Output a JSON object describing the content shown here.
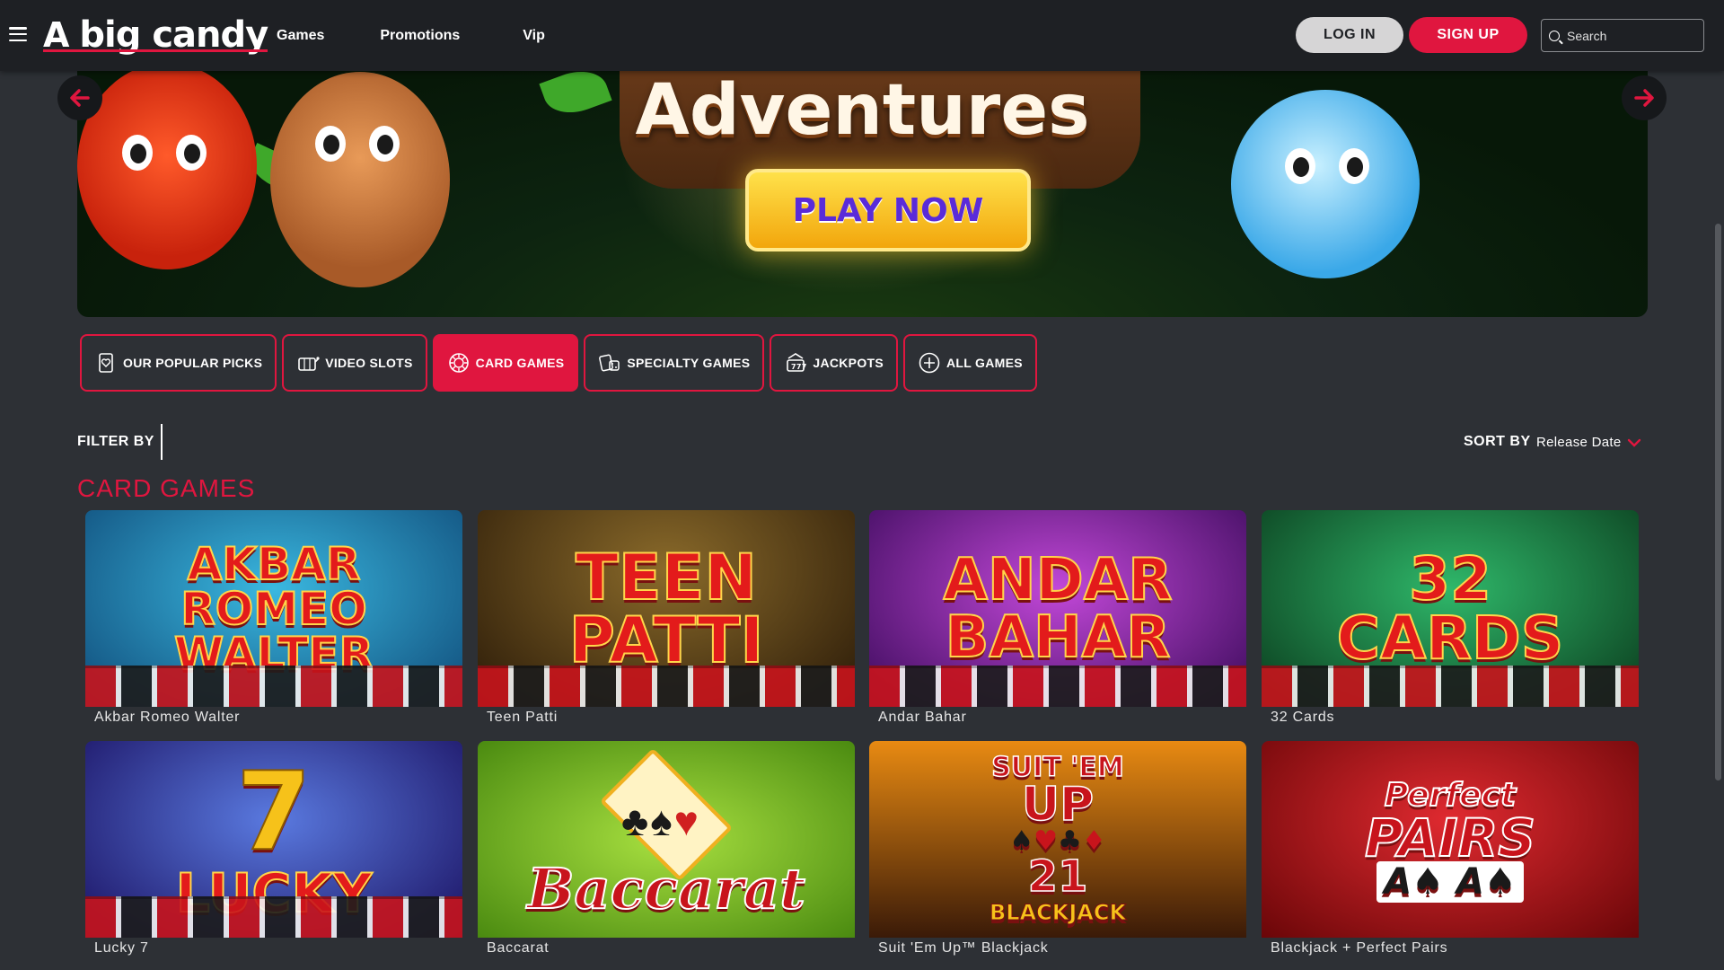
{
  "header": {
    "logo_mark": "A",
    "logo_text": "big candy",
    "nav": [
      "Games",
      "Promotions",
      "Vip"
    ],
    "login_label": "LOG IN",
    "signup_label": "SIGN UP",
    "search_placeholder": "Search"
  },
  "banner": {
    "title": "Adventures",
    "cta": "PLAY NOW",
    "prev_icon": "arrow-left-icon",
    "next_icon": "arrow-right-icon"
  },
  "tabs": [
    {
      "label": "OUR POPULAR PICKS",
      "icon": "heart-card-icon",
      "active": false
    },
    {
      "label": "VIDEO SLOTS",
      "icon": "slot-machine-icon",
      "active": false
    },
    {
      "label": "CARD GAMES",
      "icon": "poker-chip-icon",
      "active": true
    },
    {
      "label": "SPECIALTY GAMES",
      "icon": "cards-dice-icon",
      "active": false
    },
    {
      "label": "JACKPOTS",
      "icon": "jackpot-icon",
      "active": false
    },
    {
      "label": "ALL GAMES",
      "icon": "plus-circle-icon",
      "active": false
    }
  ],
  "filter": {
    "label": "FILTER BY"
  },
  "sort": {
    "label": "SORT BY",
    "value": "Release Date"
  },
  "section_title": "CARD GAMES",
  "games": [
    {
      "name": "Akbar Romeo Walter",
      "art": "AKBAR\nROMEO\nWALTER",
      "bg": "#1c7fb0"
    },
    {
      "name": "Teen Patti",
      "art": "TEEN\nPATTI",
      "bg": "#5a3a12"
    },
    {
      "name": "Andar Bahar",
      "art": "ANDAR\nBAHAR",
      "bg": "#6b1e8a"
    },
    {
      "name": "32 Cards",
      "art": "32\nCARDS",
      "bg": "#116b3a"
    },
    {
      "name": "Lucky 7",
      "art": "7\nLUCKY",
      "bg": "#3a2a8a"
    },
    {
      "name": "Baccarat",
      "art": "Baccarat",
      "bg": "#6fb81a"
    },
    {
      "name": "Suit 'Em Up™ Blackjack",
      "art": "SUIT 'EM\nUP\n21\nBLACKJACK",
      "bg": "#d87a14"
    },
    {
      "name": "Blackjack + Perfect Pairs",
      "art": "Perfect\nPAIRS",
      "bg": "#b01218"
    }
  ],
  "colors": {
    "accent": "#e0163f",
    "header_bg": "#1e2024",
    "page_bg": "#2d3035"
  }
}
